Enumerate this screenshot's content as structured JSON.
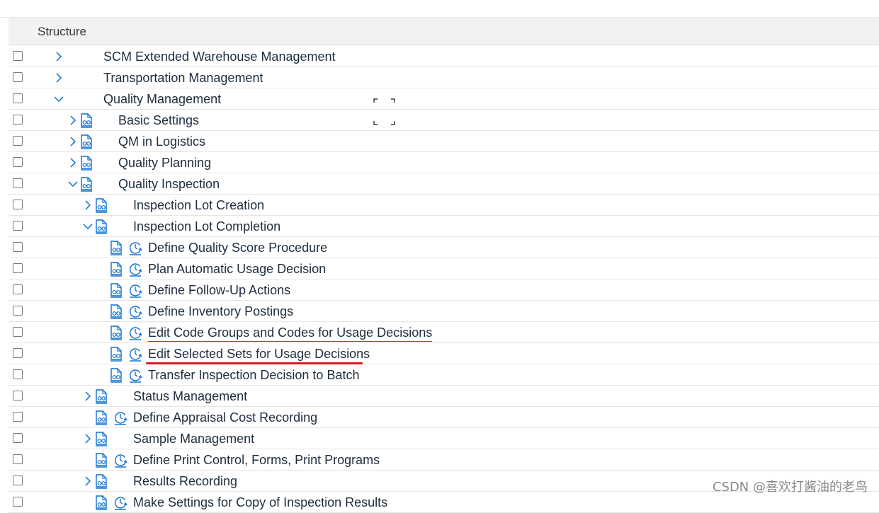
{
  "header": {
    "title": "Structure"
  },
  "rows": [
    {
      "label": "SCM Extended Warehouse Management"
    },
    {
      "label": "Transportation Management"
    },
    {
      "label": "Quality Management"
    },
    {
      "label": "Basic Settings"
    },
    {
      "label": "QM in Logistics"
    },
    {
      "label": "Quality Planning"
    },
    {
      "label": "Quality Inspection"
    },
    {
      "label": "Inspection Lot Creation"
    },
    {
      "label": "Inspection Lot Completion"
    },
    {
      "label": "Define Quality Score Procedure"
    },
    {
      "label": "Plan Automatic Usage Decision"
    },
    {
      "label": "Define Follow-Up Actions"
    },
    {
      "label": "Define Inventory Postings"
    },
    {
      "label": "Edit Code Groups and Codes for Usage Decisions"
    },
    {
      "label": "Edit Selected Sets for Usage Decisions"
    },
    {
      "label": "Transfer Inspection Decision to Batch"
    },
    {
      "label": "Status Management"
    },
    {
      "label": "Define Appraisal Cost Recording"
    },
    {
      "label": "Sample Management"
    },
    {
      "label": "Define Print Control, Forms, Print Programs"
    },
    {
      "label": "Results Recording"
    },
    {
      "label": "Make Settings for Copy of Inspection Results"
    }
  ],
  "watermark": "CSDN @喜欢打酱油的老鸟",
  "colors": {
    "accent": "#0a6ed1",
    "highlight": "#e0141e"
  }
}
